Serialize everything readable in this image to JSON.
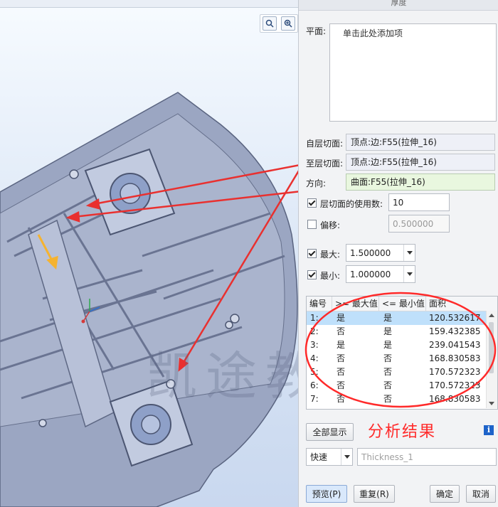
{
  "panel": {
    "title": "厚度",
    "plane_label": "平面:",
    "plane_placeholder": "单击此处添加项",
    "from_label": "自层切面:",
    "from_value": "顶点:边:F55(拉伸_16)",
    "to_label": "至层切面:",
    "to_value": "顶点:边:F55(拉伸_16)",
    "direction_label": "方向:",
    "direction_value": "曲面:F55(拉伸_16)",
    "slices_checkbox": {
      "label": "层切面的使用数:",
      "checked": true,
      "value": "10"
    },
    "offset_checkbox": {
      "label": "偏移:",
      "checked": false,
      "value": "0.500000"
    },
    "max": {
      "label": "最大:",
      "checked": true,
      "value": "1.500000"
    },
    "min": {
      "label": "最小:",
      "checked": true,
      "value": "1.000000"
    }
  },
  "table": {
    "headers": [
      "编号",
      ">= 最大值",
      "<= 最小值",
      "面积"
    ],
    "rows": [
      [
        "1:",
        "是",
        "是",
        "120.532617"
      ],
      [
        "2:",
        "否",
        "是",
        "159.432385"
      ],
      [
        "3:",
        "是",
        "是",
        "239.041543"
      ],
      [
        "4:",
        "否",
        "否",
        "168.830583"
      ],
      [
        "5:",
        "否",
        "否",
        "170.572323"
      ],
      [
        "6:",
        "否",
        "否",
        "170.572323"
      ],
      [
        "7:",
        "否",
        "否",
        "168.830583"
      ]
    ],
    "selected_row": 0
  },
  "show_all_button": "全部显示",
  "annotation": "分析结果",
  "watermark": "凯途教育",
  "quick_mode": "快速",
  "name_field_placeholder": "Thickness_1",
  "buttons": {
    "preview": "预览(P)",
    "repeat": "重复(R)",
    "ok": "确定",
    "cancel": "取消"
  },
  "colors": {
    "selected_row": "#bfe0fb",
    "direction_bg": "#e9f7df",
    "arrow": "#e9302f",
    "annotation": "#ff2a2a"
  }
}
